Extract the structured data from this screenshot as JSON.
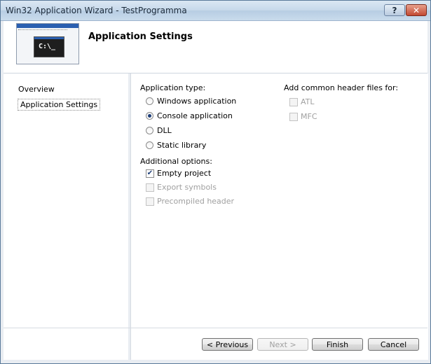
{
  "window": {
    "title": "Win32 Application Wizard - TestProgramma"
  },
  "titlebar": {
    "help_glyph": "?",
    "close_glyph": "✕"
  },
  "header": {
    "title": "Application Settings",
    "icon_prompt": "C:\\_"
  },
  "sidebar": {
    "items": [
      {
        "label": "Overview"
      },
      {
        "label": "Application Settings",
        "selected": true
      }
    ]
  },
  "app_type": {
    "label": "Application type:",
    "options": [
      {
        "label": "Windows application",
        "checked": false
      },
      {
        "label": "Console application",
        "checked": true
      },
      {
        "label": "DLL",
        "checked": false
      },
      {
        "label": "Static library",
        "checked": false
      }
    ]
  },
  "additional_options": {
    "label": "Additional options:",
    "options": [
      {
        "label": "Empty project",
        "checked": true,
        "enabled": true
      },
      {
        "label": "Export symbols",
        "checked": false,
        "enabled": false
      },
      {
        "label": "Precompiled header",
        "checked": false,
        "enabled": false
      }
    ]
  },
  "common_headers": {
    "label": "Add common header files for:",
    "options": [
      {
        "label": "ATL",
        "checked": false,
        "enabled": false
      },
      {
        "label": "MFC",
        "checked": false,
        "enabled": false
      }
    ]
  },
  "buttons": {
    "previous": "< Previous",
    "next": "Next >",
    "finish": "Finish",
    "cancel": "Cancel"
  },
  "check_glyph": "✔"
}
